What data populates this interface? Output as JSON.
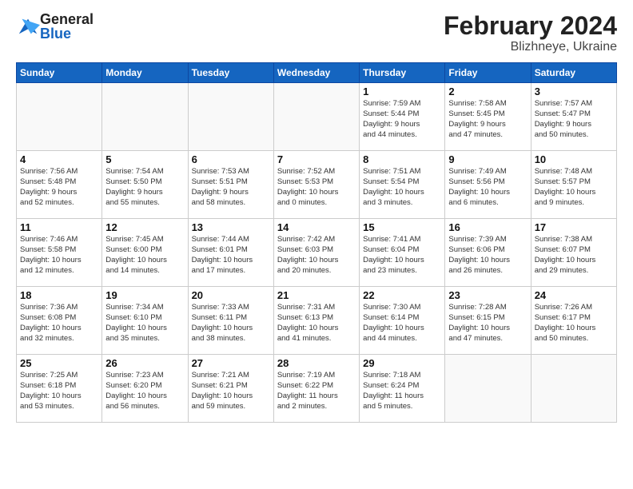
{
  "header": {
    "logo_general": "General",
    "logo_blue": "Blue",
    "month_title": "February 2024",
    "location": "Blizhneye, Ukraine"
  },
  "weekdays": [
    "Sunday",
    "Monday",
    "Tuesday",
    "Wednesday",
    "Thursday",
    "Friday",
    "Saturday"
  ],
  "weeks": [
    [
      {
        "day": "",
        "info": ""
      },
      {
        "day": "",
        "info": ""
      },
      {
        "day": "",
        "info": ""
      },
      {
        "day": "",
        "info": ""
      },
      {
        "day": "1",
        "info": "Sunrise: 7:59 AM\nSunset: 5:44 PM\nDaylight: 9 hours\nand 44 minutes."
      },
      {
        "day": "2",
        "info": "Sunrise: 7:58 AM\nSunset: 5:45 PM\nDaylight: 9 hours\nand 47 minutes."
      },
      {
        "day": "3",
        "info": "Sunrise: 7:57 AM\nSunset: 5:47 PM\nDaylight: 9 hours\nand 50 minutes."
      }
    ],
    [
      {
        "day": "4",
        "info": "Sunrise: 7:56 AM\nSunset: 5:48 PM\nDaylight: 9 hours\nand 52 minutes."
      },
      {
        "day": "5",
        "info": "Sunrise: 7:54 AM\nSunset: 5:50 PM\nDaylight: 9 hours\nand 55 minutes."
      },
      {
        "day": "6",
        "info": "Sunrise: 7:53 AM\nSunset: 5:51 PM\nDaylight: 9 hours\nand 58 minutes."
      },
      {
        "day": "7",
        "info": "Sunrise: 7:52 AM\nSunset: 5:53 PM\nDaylight: 10 hours\nand 0 minutes."
      },
      {
        "day": "8",
        "info": "Sunrise: 7:51 AM\nSunset: 5:54 PM\nDaylight: 10 hours\nand 3 minutes."
      },
      {
        "day": "9",
        "info": "Sunrise: 7:49 AM\nSunset: 5:56 PM\nDaylight: 10 hours\nand 6 minutes."
      },
      {
        "day": "10",
        "info": "Sunrise: 7:48 AM\nSunset: 5:57 PM\nDaylight: 10 hours\nand 9 minutes."
      }
    ],
    [
      {
        "day": "11",
        "info": "Sunrise: 7:46 AM\nSunset: 5:58 PM\nDaylight: 10 hours\nand 12 minutes."
      },
      {
        "day": "12",
        "info": "Sunrise: 7:45 AM\nSunset: 6:00 PM\nDaylight: 10 hours\nand 14 minutes."
      },
      {
        "day": "13",
        "info": "Sunrise: 7:44 AM\nSunset: 6:01 PM\nDaylight: 10 hours\nand 17 minutes."
      },
      {
        "day": "14",
        "info": "Sunrise: 7:42 AM\nSunset: 6:03 PM\nDaylight: 10 hours\nand 20 minutes."
      },
      {
        "day": "15",
        "info": "Sunrise: 7:41 AM\nSunset: 6:04 PM\nDaylight: 10 hours\nand 23 minutes."
      },
      {
        "day": "16",
        "info": "Sunrise: 7:39 AM\nSunset: 6:06 PM\nDaylight: 10 hours\nand 26 minutes."
      },
      {
        "day": "17",
        "info": "Sunrise: 7:38 AM\nSunset: 6:07 PM\nDaylight: 10 hours\nand 29 minutes."
      }
    ],
    [
      {
        "day": "18",
        "info": "Sunrise: 7:36 AM\nSunset: 6:08 PM\nDaylight: 10 hours\nand 32 minutes."
      },
      {
        "day": "19",
        "info": "Sunrise: 7:34 AM\nSunset: 6:10 PM\nDaylight: 10 hours\nand 35 minutes."
      },
      {
        "day": "20",
        "info": "Sunrise: 7:33 AM\nSunset: 6:11 PM\nDaylight: 10 hours\nand 38 minutes."
      },
      {
        "day": "21",
        "info": "Sunrise: 7:31 AM\nSunset: 6:13 PM\nDaylight: 10 hours\nand 41 minutes."
      },
      {
        "day": "22",
        "info": "Sunrise: 7:30 AM\nSunset: 6:14 PM\nDaylight: 10 hours\nand 44 minutes."
      },
      {
        "day": "23",
        "info": "Sunrise: 7:28 AM\nSunset: 6:15 PM\nDaylight: 10 hours\nand 47 minutes."
      },
      {
        "day": "24",
        "info": "Sunrise: 7:26 AM\nSunset: 6:17 PM\nDaylight: 10 hours\nand 50 minutes."
      }
    ],
    [
      {
        "day": "25",
        "info": "Sunrise: 7:25 AM\nSunset: 6:18 PM\nDaylight: 10 hours\nand 53 minutes."
      },
      {
        "day": "26",
        "info": "Sunrise: 7:23 AM\nSunset: 6:20 PM\nDaylight: 10 hours\nand 56 minutes."
      },
      {
        "day": "27",
        "info": "Sunrise: 7:21 AM\nSunset: 6:21 PM\nDaylight: 10 hours\nand 59 minutes."
      },
      {
        "day": "28",
        "info": "Sunrise: 7:19 AM\nSunset: 6:22 PM\nDaylight: 11 hours\nand 2 minutes."
      },
      {
        "day": "29",
        "info": "Sunrise: 7:18 AM\nSunset: 6:24 PM\nDaylight: 11 hours\nand 5 minutes."
      },
      {
        "day": "",
        "info": ""
      },
      {
        "day": "",
        "info": ""
      }
    ]
  ]
}
